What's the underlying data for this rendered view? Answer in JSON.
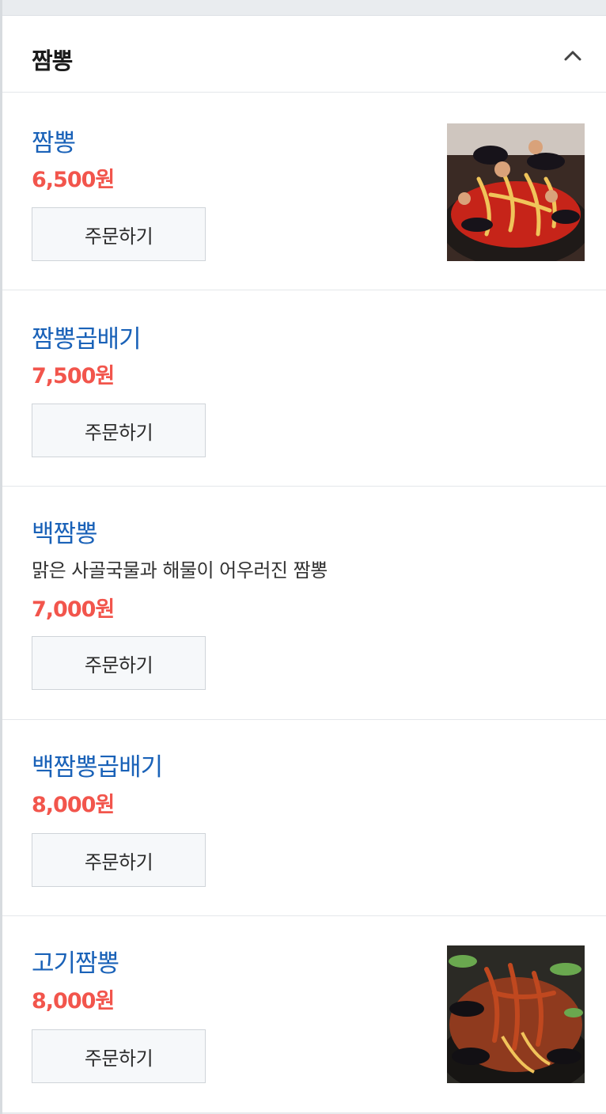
{
  "section": {
    "title": "짬뽕",
    "collapse_icon": "chevron-up-icon"
  },
  "items": [
    {
      "name": "짬뽕",
      "description": "",
      "price": "6,500원",
      "order_label": "주문하기",
      "has_image": true,
      "image_name": "jjamppong-photo"
    },
    {
      "name": "짬뽕곱배기",
      "description": "",
      "price": "7,500원",
      "order_label": "주문하기",
      "has_image": false
    },
    {
      "name": "백짬뽕",
      "description": "맑은 사골국물과 해물이 어우러진 짬뽕",
      "price": "7,000원",
      "order_label": "주문하기",
      "has_image": false
    },
    {
      "name": "백짬뽕곱배기",
      "description": "",
      "price": "8,000원",
      "order_label": "주문하기",
      "has_image": false
    },
    {
      "name": "고기짬뽕",
      "description": "",
      "price": "8,000원",
      "order_label": "주문하기",
      "has_image": true,
      "image_name": "meat-jjamppong-photo"
    }
  ],
  "colors": {
    "item_name": "#1a62b8",
    "price": "#f2554c",
    "button_bg": "#f6f8fa"
  }
}
